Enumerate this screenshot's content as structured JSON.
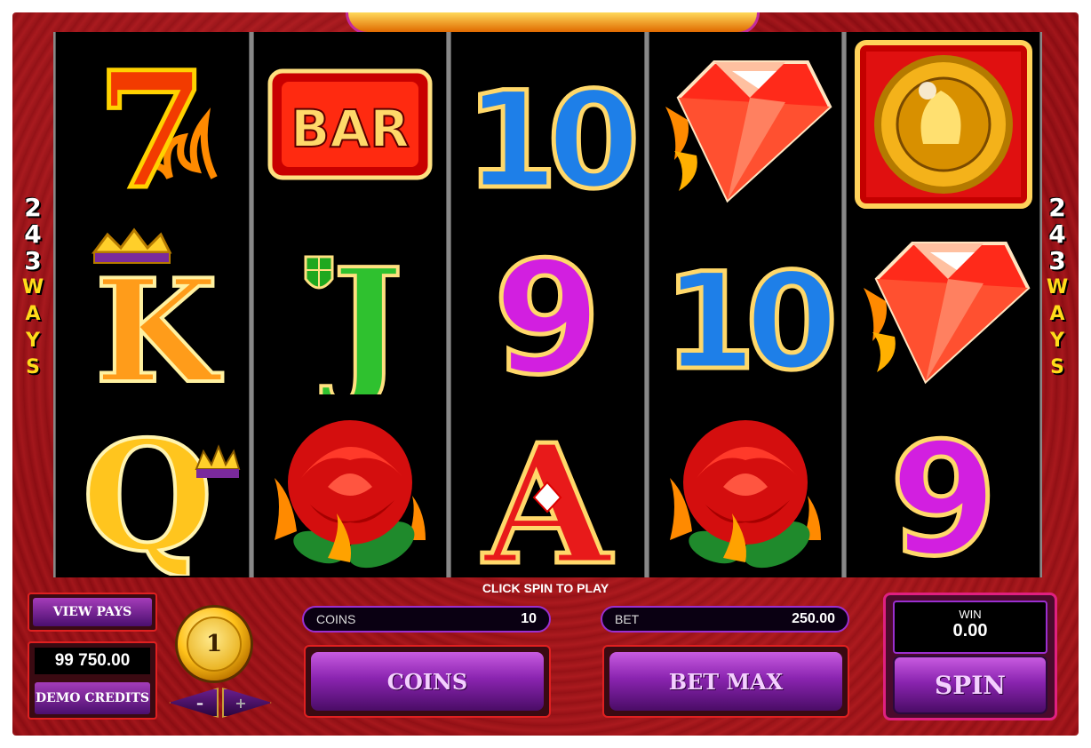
{
  "game": {
    "ways_left": [
      "2",
      "4",
      "3"
    ],
    "ways_word": [
      "W",
      "A",
      "Y",
      "S"
    ],
    "ways_right": [
      "2",
      "4",
      "3"
    ],
    "status": "CLICK SPIN TO PLAY"
  },
  "reels": [
    {
      "symbols": [
        {
          "name": "seven",
          "label": "7"
        },
        {
          "name": "king",
          "label": "K"
        },
        {
          "name": "queen",
          "label": "Q"
        }
      ]
    },
    {
      "symbols": [
        {
          "name": "bar",
          "label": "BAR"
        },
        {
          "name": "jack",
          "label": "J"
        },
        {
          "name": "rose",
          "label": ""
        }
      ]
    },
    {
      "symbols": [
        {
          "name": "ten",
          "label": "10"
        },
        {
          "name": "nine",
          "label": "9"
        },
        {
          "name": "ace",
          "label": "A"
        }
      ]
    },
    {
      "symbols": [
        {
          "name": "diamond",
          "label": ""
        },
        {
          "name": "ten",
          "label": "10"
        },
        {
          "name": "rose",
          "label": ""
        }
      ]
    },
    {
      "symbols": [
        {
          "name": "coin-scatter",
          "label": ""
        },
        {
          "name": "diamond",
          "label": ""
        },
        {
          "name": "nine",
          "label": "9"
        }
      ]
    }
  ],
  "controls": {
    "view_pays": "VIEW PAYS",
    "credits_value": "99 750.00",
    "credits_label": "DEMO CREDITS",
    "coin_size": "1",
    "decrease": "–",
    "increase": "+",
    "coins_label": "COINS",
    "coins_value": "10",
    "bet_label": "BET",
    "bet_value": "250.00",
    "coins_button": "COINS",
    "bet_max_button": "BET MAX",
    "win_label": "WIN",
    "win_value": "0.00",
    "spin_button": "SPIN"
  },
  "colors": {
    "frame": "#9c141a",
    "button_purple": "#8a24b0",
    "ways_yellow": "#ffdc1a"
  }
}
